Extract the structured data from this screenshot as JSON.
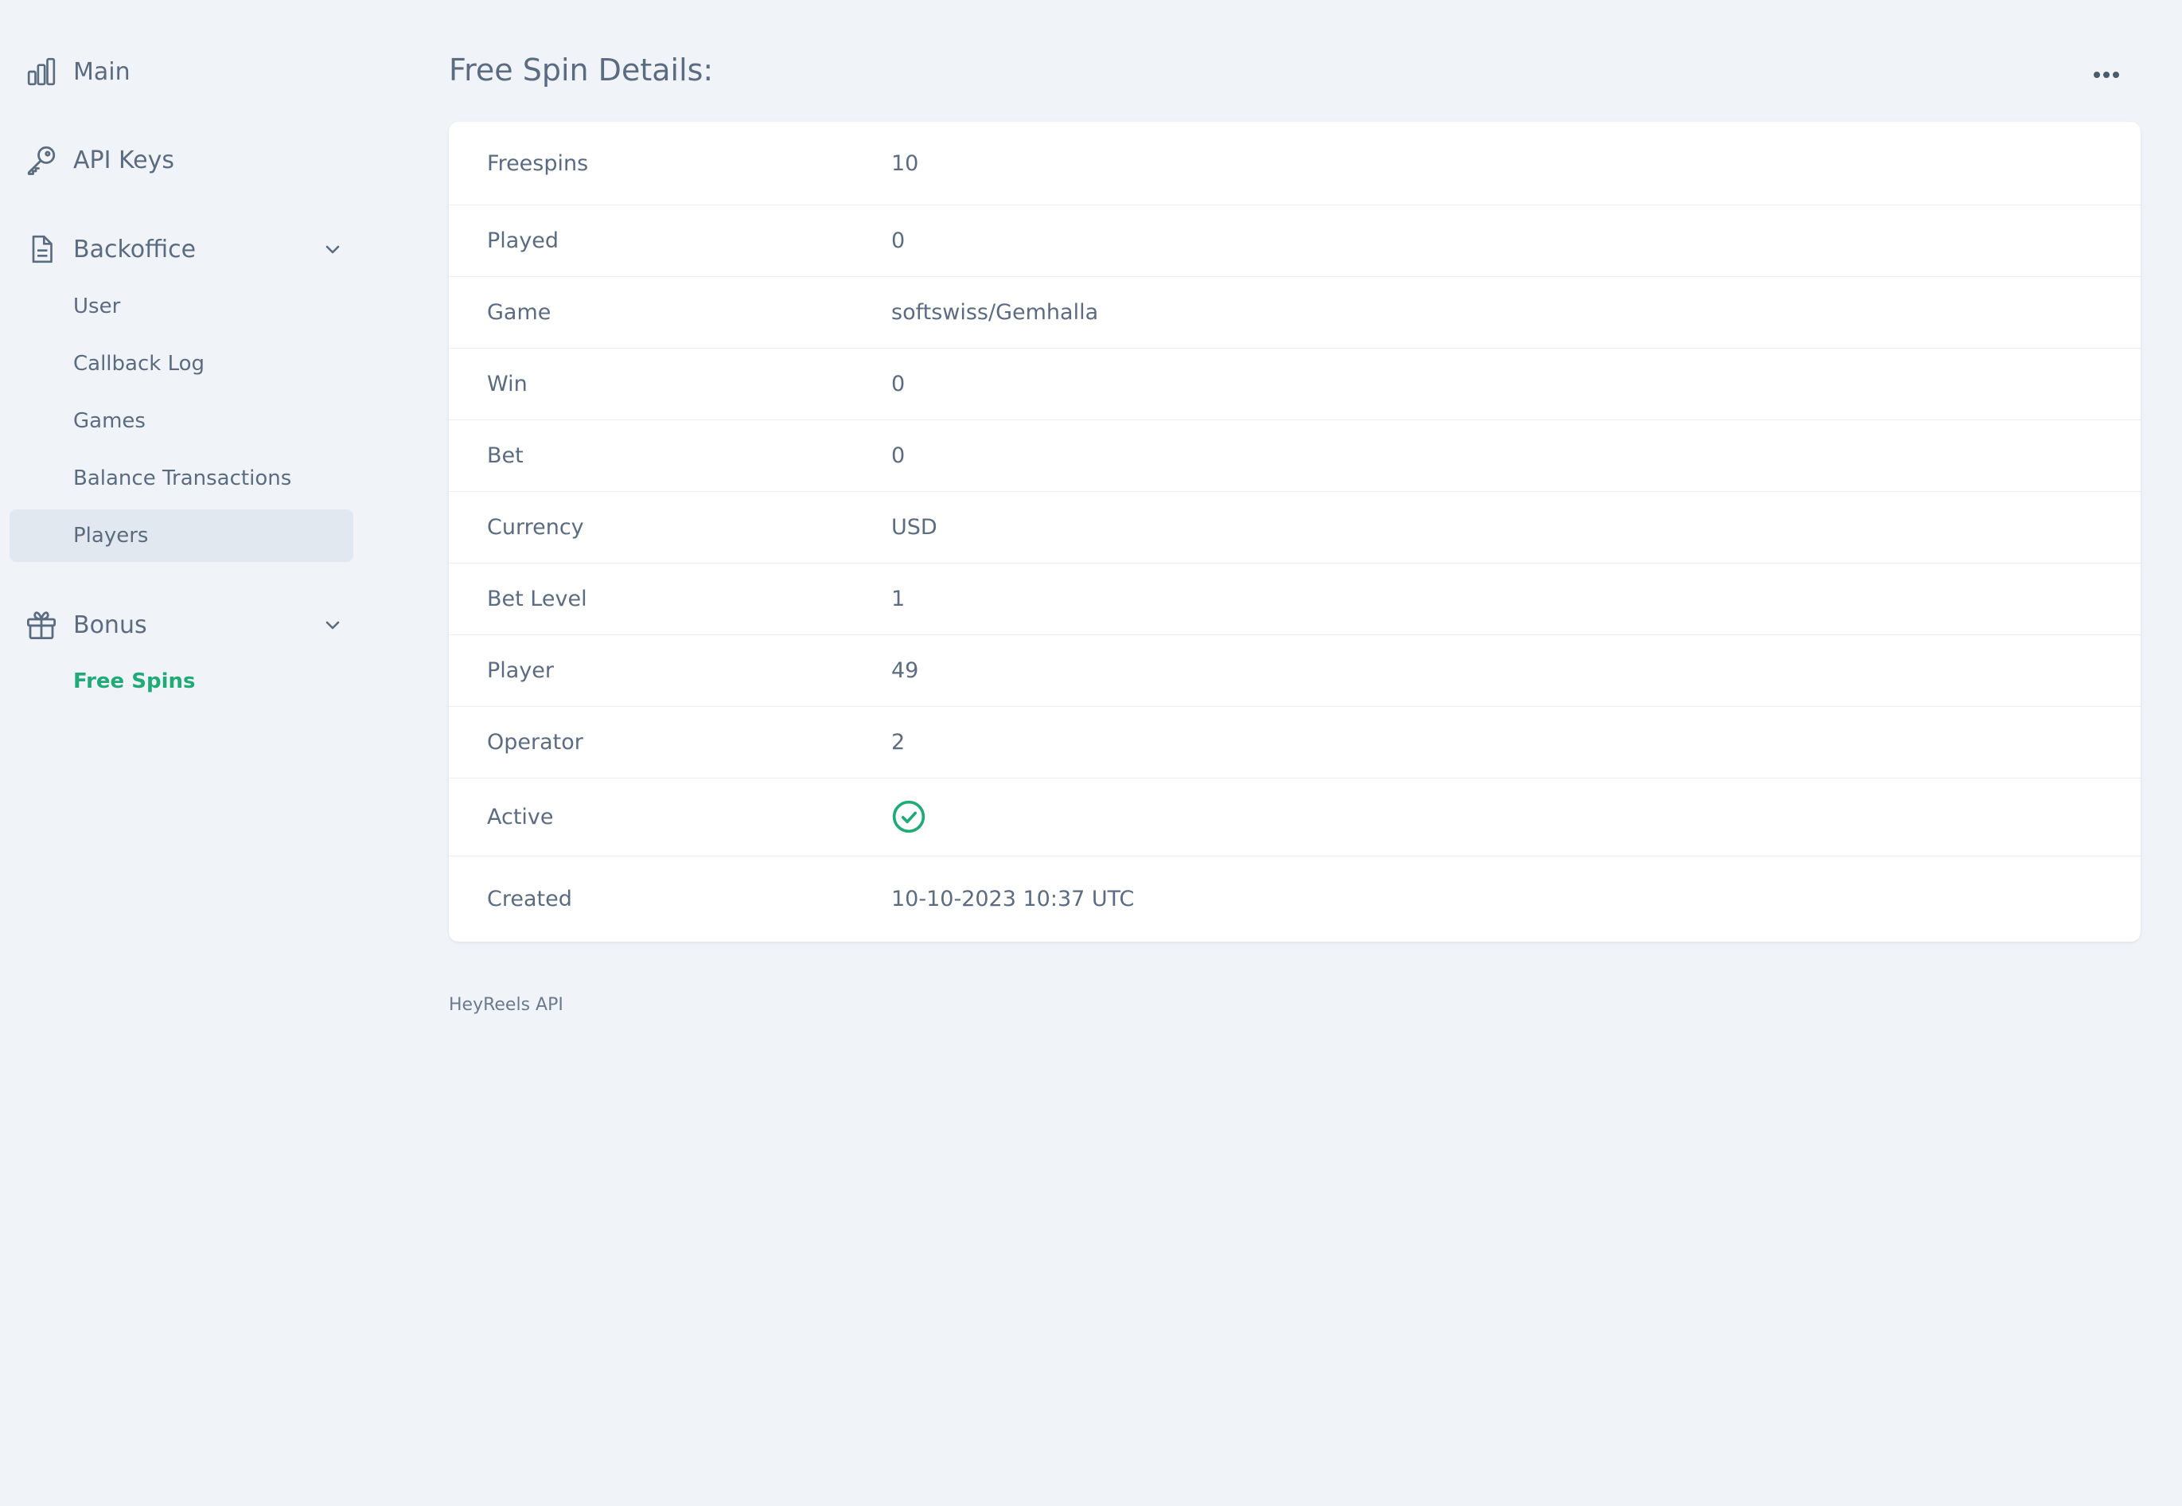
{
  "sidebar": {
    "main_label": "Main",
    "api_keys_label": "API Keys",
    "backoffice": {
      "label": "Backoffice",
      "items": [
        "User",
        "Callback Log",
        "Games",
        "Balance Transactions",
        "Players"
      ]
    },
    "bonus": {
      "label": "Bonus",
      "items": [
        "Free Spins"
      ]
    }
  },
  "page": {
    "title": "Free Spin Details:"
  },
  "details": [
    {
      "label": "Freespins",
      "value": "10"
    },
    {
      "label": "Played",
      "value": "0"
    },
    {
      "label": "Game",
      "value": "softswiss/Gemhalla"
    },
    {
      "label": "Win",
      "value": "0"
    },
    {
      "label": "Bet",
      "value": "0"
    },
    {
      "label": "Currency",
      "value": "USD"
    },
    {
      "label": "Bet Level",
      "value": "1"
    },
    {
      "label": "Player",
      "value": "49"
    },
    {
      "label": "Operator",
      "value": "2"
    },
    {
      "label": "Active",
      "value": null,
      "icon": "check-circle-icon"
    },
    {
      "label": "Created",
      "value": "10-10-2023 10:37 UTC"
    }
  ],
  "footer": {
    "text": "HeyReels API"
  },
  "colors": {
    "accent": "#1faa76",
    "text": "#5b6b80",
    "background": "#f0f4f9",
    "active_item_bg": "#e2e8ef"
  }
}
